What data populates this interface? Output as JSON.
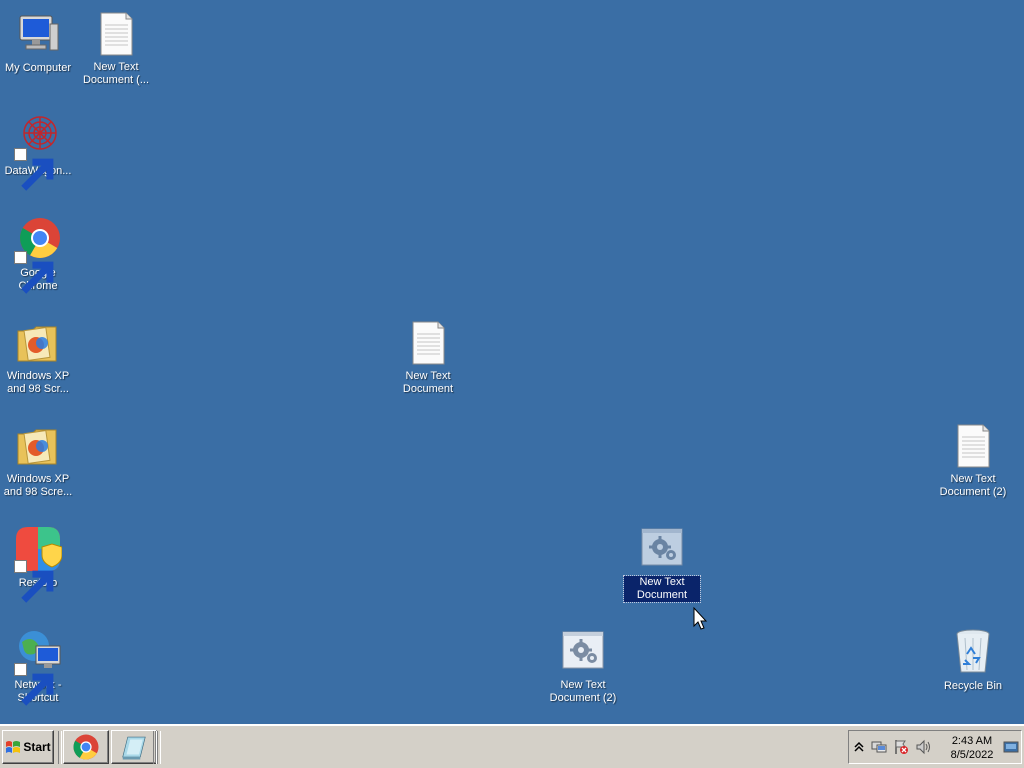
{
  "desktop": {
    "background_color": "#3a6ea5",
    "icons": [
      {
        "label": "My Computer",
        "icon": "computer-icon"
      },
      {
        "label": "New Text Document (...",
        "icon": "text-document-icon"
      },
      {
        "label": "DataWagon...",
        "icon": "datawagon-icon",
        "shortcut": true
      },
      {
        "label": "Google Chrome",
        "icon": "chrome-icon",
        "shortcut": true
      },
      {
        "label": "Windows XP and 98 Scr...",
        "icon": "folder-icon"
      },
      {
        "label": "Windows XP and 98 Scre...",
        "icon": "folder-icon"
      },
      {
        "label": "Restoro",
        "icon": "restoro-icon",
        "shortcut": true
      },
      {
        "label": "Network - Shortcut",
        "icon": "network-icon",
        "shortcut": true
      },
      {
        "label": "New Text Document",
        "icon": "text-document-icon"
      },
      {
        "label": "New Text Document (2)",
        "icon": "text-document-icon"
      },
      {
        "label": "New Text Document",
        "icon": "settings-file-icon",
        "selected": true
      },
      {
        "label": "New Text Document (2)",
        "icon": "settings-file-icon"
      },
      {
        "label": "Recycle Bin",
        "icon": "recycle-bin-icon"
      }
    ]
  },
  "taskbar": {
    "start_label": "Start",
    "quick_launch": [
      {
        "name": "chrome-quicklaunch",
        "icon": "chrome-icon"
      },
      {
        "name": "show-desktop-quicklaunch",
        "icon": "show-desktop-icon"
      }
    ],
    "tray": {
      "icons": [
        "show-hidden-icons-chevron-icon",
        "network-icon",
        "action-center-flag-icon",
        "volume-icon"
      ],
      "time": "2:43 AM",
      "date": "8/5/2022"
    }
  }
}
